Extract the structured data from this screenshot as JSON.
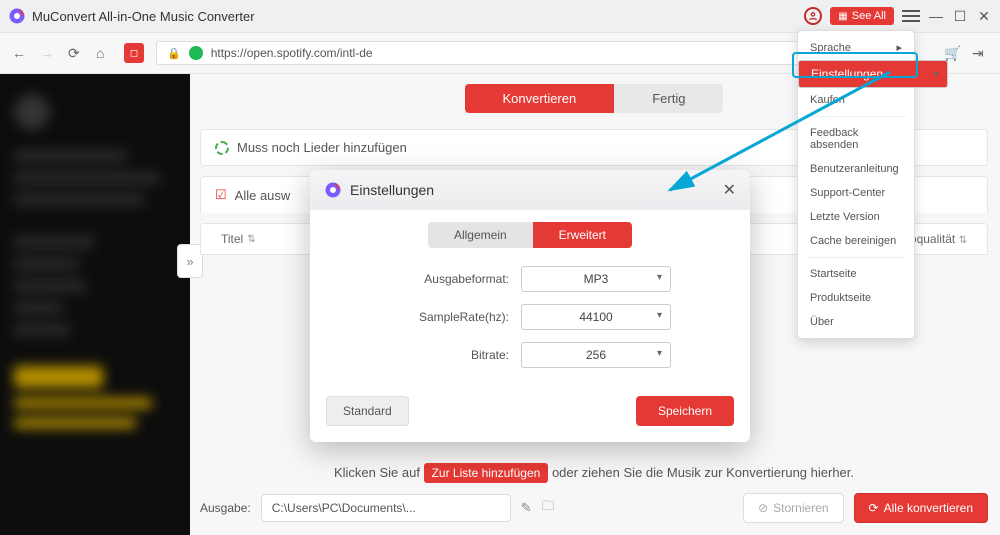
{
  "titlebar": {
    "app_name": "MuConvert All-in-One Music Converter",
    "see_all": "See All"
  },
  "addr": {
    "url": "https://open.spotify.com/intl-de"
  },
  "tabs": {
    "convert": "Konvertieren",
    "done": "Fertig"
  },
  "info": {
    "need_songs": "Muss noch Lieder hinzufügen",
    "select_all_prefix": "Alle ausw"
  },
  "table": {
    "title": "Titel",
    "quality_suffix": "oqualität"
  },
  "hint": {
    "pre": "Klicken Sie auf",
    "chip": "Zur Liste hinzufügen",
    "post": "oder ziehen Sie die Musik zur Konvertierung hierher."
  },
  "bottom": {
    "output_label": "Ausgabe:",
    "output_path": "C:\\Users\\PC\\Documents\\...",
    "cancel": "Stornieren",
    "convert_all": "Alle konvertieren"
  },
  "menu": {
    "sprache": "Sprache",
    "einstellungen": "Einstellungen",
    "kaufen": "Kaufen",
    "feedback": "Feedback absenden",
    "manual": "Benutzeranleitung",
    "support": "Support-Center",
    "version": "Letzte Version",
    "cache": "Cache bereinigen",
    "start": "Startseite",
    "product": "Produktseite",
    "about": "Über"
  },
  "dialog": {
    "title": "Einstellungen",
    "tab_general": "Allgemein",
    "tab_advanced": "Erweitert",
    "format_label": "Ausgabeformat:",
    "format_value": "MP3",
    "rate_label": "SampleRate(hz):",
    "rate_value": "44100",
    "bitrate_label": "Bitrate:",
    "bitrate_value": "256",
    "standard": "Standard",
    "save": "Speichern"
  }
}
